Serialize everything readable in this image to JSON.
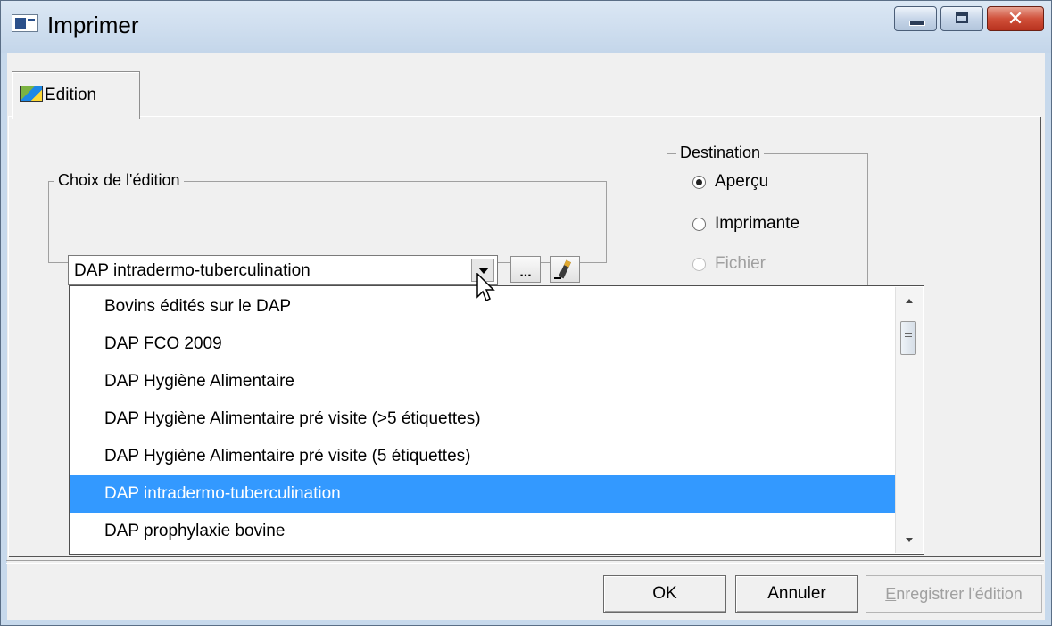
{
  "window": {
    "title": "Imprimer",
    "close_glyph": "✕"
  },
  "tabs": [
    {
      "label": "Edition",
      "icon": "edition-icon"
    }
  ],
  "choix": {
    "legend": "Choix de l'édition",
    "value": "DAP intradermo-tuberculination",
    "browse_label": "...",
    "edit_icon": "pencil-icon"
  },
  "destination": {
    "legend": "Destination",
    "options": [
      {
        "label": "Aperçu",
        "checked": true,
        "enabled": true
      },
      {
        "label": "Imprimante",
        "checked": false,
        "enabled": true
      },
      {
        "label": "Fichier",
        "checked": false,
        "enabled": false
      }
    ]
  },
  "dropdown": {
    "items": [
      "Bovins édités sur le DAP",
      "DAP FCO 2009",
      "DAP Hygiène Alimentaire",
      "DAP Hygiène Alimentaire pré visite (>5 étiquettes)",
      "DAP Hygiène Alimentaire pré visite (5 étiquettes)",
      "DAP intradermo-tuberculination",
      "DAP prophylaxie bovine"
    ],
    "selected_index": 5
  },
  "footer": {
    "ok_label": "OK",
    "cancel_label": "Annuler",
    "save_label_mnemonic": "E",
    "save_label_rest": "nregistrer l'édition"
  },
  "colors": {
    "selection": "#3399ff",
    "disabled_text": "#a0a0a0"
  }
}
